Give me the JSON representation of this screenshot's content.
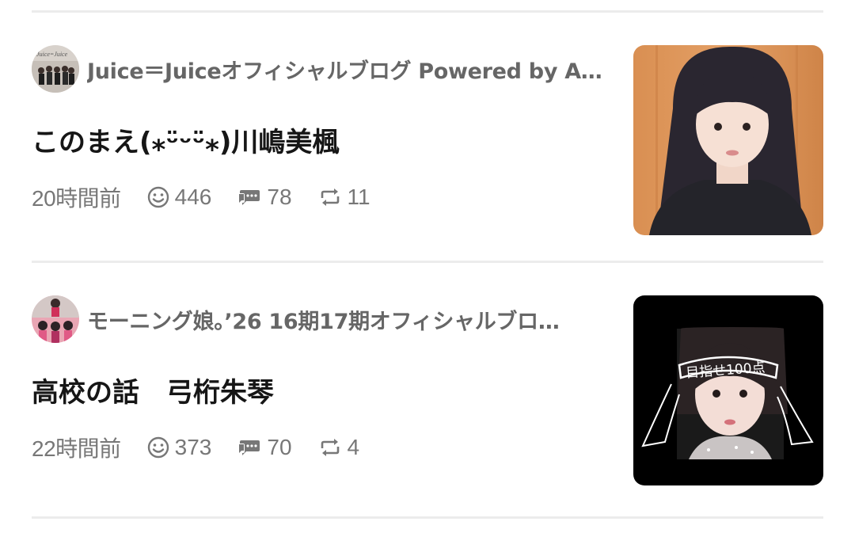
{
  "posts": [
    {
      "blog_name": "Juice＝Juiceオフィシャルブログ Powered by A…",
      "avatar_text": "Juice=Juice",
      "title": "このまえ(⁎ᵕ̈ᵕᵕ̈⁎)川嶋美楓",
      "time": "20時間前",
      "likes": "446",
      "comments": "78",
      "reblogs": "11"
    },
    {
      "blog_name": "モーニング娘。’26 16期17期オフィシャルブロ…",
      "title": "高校の話　弓桁朱琴",
      "time": "22時間前",
      "likes": "373",
      "comments": "70",
      "reblogs": "4",
      "thumb_text": "目指せ100点"
    }
  ],
  "icons": {
    "like": "smile-icon",
    "comment": "speech-bubble-icon",
    "reblog": "repeat-icon"
  },
  "colors": {
    "meta_text": "#777777",
    "title_text": "#161616",
    "blog_name_text": "#666666",
    "divider": "#ececec"
  }
}
